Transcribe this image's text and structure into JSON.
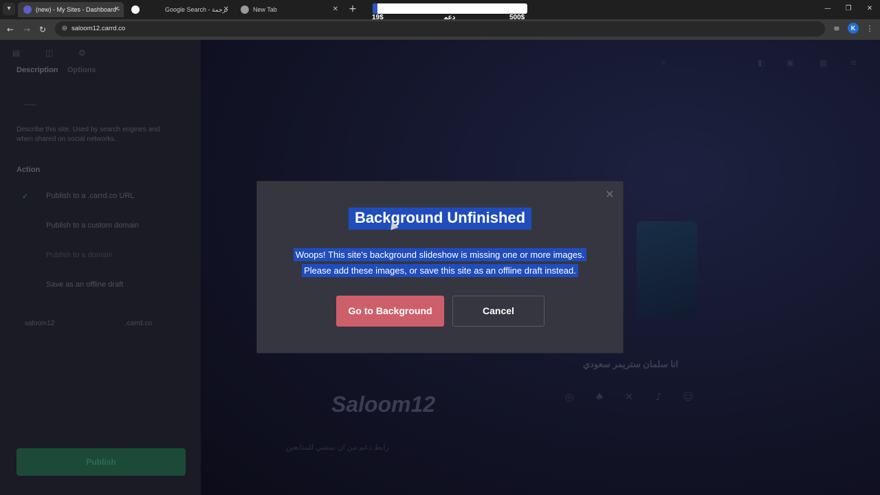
{
  "browser": {
    "tabs": [
      {
        "title": "(new) - My Sites - Dashboard -",
        "active": true,
        "favicon_color": "#5b5fc7"
      },
      {
        "title": "Google Search - ترجمة",
        "active": false,
        "favicon_color": "#ffffff"
      },
      {
        "title": "New Tab",
        "active": false,
        "favicon_color": "#9a9a9a"
      }
    ],
    "url": "saloom12.carrd.co",
    "profile_initial": "K"
  },
  "overlay_progress": {
    "min_label": "19$",
    "center_label": "دعم",
    "max_label": "500$",
    "fill_fraction": 0.03
  },
  "left_panel": {
    "tabs": [
      "Description",
      "Options"
    ],
    "field_value": "___",
    "help_text": [
      "Describe this site. Used by search engines and",
      "when shared on social networks."
    ],
    "action_heading": "Action",
    "options": [
      "Publish to a .carrd.co URL",
      "Publish to a custom domain",
      "Publish to a domain",
      "Save as an offline draft"
    ],
    "subdomain_value": "saloom12",
    "subdomain_suffix": ".carrd.co",
    "publish_label": "Publish"
  },
  "site_preview": {
    "title": "Saloom12",
    "subtitle": "انا سلمان ستريمر سعودي",
    "description": "رابط دعم من ان يمشي للمتابعين"
  },
  "modal": {
    "title": "Background Unfinished",
    "body_line1": "Woops! This site's background slideshow is missing one or more images.",
    "body_line2": "Please add these images, or save this site as an offline draft instead.",
    "primary_label": "Go to Background",
    "secondary_label": "Cancel",
    "primary_color": "#cd5f6b",
    "highlight_color": "#204dbd"
  }
}
